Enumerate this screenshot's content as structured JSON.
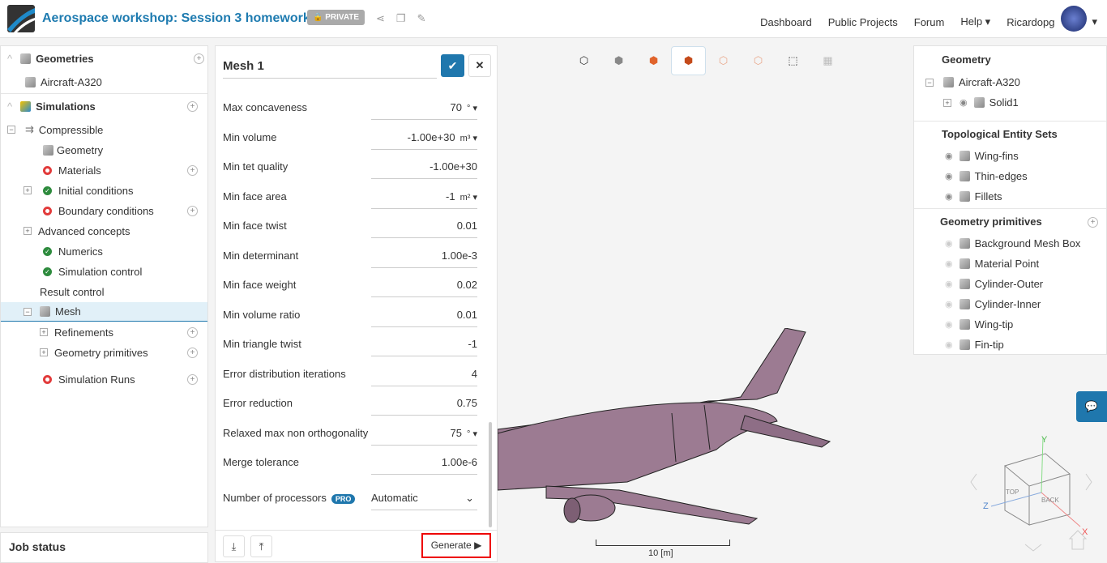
{
  "header": {
    "title": "Aerospace workshop: Session 3 homework",
    "privacy": "PRIVATE",
    "nav": [
      "Dashboard",
      "Public Projects",
      "Forum",
      "Help",
      "Ricardopg"
    ]
  },
  "tree": {
    "geometries": "Geometries",
    "geometry_item": "Aircraft-A320",
    "simulations": "Simulations",
    "items": [
      {
        "label": "Compressible",
        "status": "none"
      },
      {
        "label": "Geometry",
        "status": "ok"
      },
      {
        "label": "Materials",
        "status": "error"
      },
      {
        "label": "Initial conditions",
        "status": "ok"
      },
      {
        "label": "Boundary conditions",
        "status": "error"
      },
      {
        "label": "Advanced concepts",
        "status": "none"
      },
      {
        "label": "Numerics",
        "status": "ok"
      },
      {
        "label": "Simulation control",
        "status": "ok"
      },
      {
        "label": "Result control",
        "status": "none"
      },
      {
        "label": "Mesh",
        "status": "selected"
      },
      {
        "label": "Refinements",
        "status": "none"
      },
      {
        "label": "Geometry primitives",
        "status": "none"
      },
      {
        "label": "Simulation Runs",
        "status": "error"
      }
    ]
  },
  "job_status": "Job status",
  "mesh_panel": {
    "name": "Mesh 1",
    "generate": "Generate",
    "properties": [
      {
        "label": "Max concaveness",
        "value": "70",
        "unit": "°"
      },
      {
        "label": "Min volume",
        "value": "-1.00e+30",
        "unit": "m³"
      },
      {
        "label": "Min tet quality",
        "value": "-1.00e+30",
        "unit": ""
      },
      {
        "label": "Min face area",
        "value": "-1",
        "unit": "m²"
      },
      {
        "label": "Min face twist",
        "value": "0.01",
        "unit": ""
      },
      {
        "label": "Min determinant",
        "value": "1.00e-3",
        "unit": ""
      },
      {
        "label": "Min face weight",
        "value": "0.02",
        "unit": ""
      },
      {
        "label": "Min volume ratio",
        "value": "0.01",
        "unit": ""
      },
      {
        "label": "Min triangle twist",
        "value": "-1",
        "unit": ""
      },
      {
        "label": "Error distribution iterations",
        "value": "4",
        "unit": ""
      },
      {
        "label": "Error reduction",
        "value": "0.75",
        "unit": ""
      },
      {
        "label": "Relaxed max non orthogonality",
        "value": "75",
        "unit": "°"
      },
      {
        "label": "Merge tolerance",
        "value": "1.00e-6",
        "unit": ""
      }
    ],
    "processors_label": "Number of processors",
    "pro_badge": "PRO",
    "processors_value": "Automatic"
  },
  "right_panel": {
    "geometry": "Geometry",
    "geometry_item": "Aircraft-A320",
    "solid": "Solid1",
    "topo_title": "Topological Entity Sets",
    "topo": [
      "Wing-fins",
      "Thin-edges",
      "Fillets"
    ],
    "prim_title": "Geometry primitives",
    "prims": [
      "Background Mesh Box",
      "Material Point",
      "Cylinder-Outer",
      "Cylinder-Inner",
      "Wing-tip",
      "Fin-tip"
    ]
  },
  "viewport": {
    "scale": "10 [m]",
    "cube": {
      "top": "TOP",
      "back": "BACK",
      "x": "X",
      "y": "Y",
      "z": "Z"
    }
  },
  "colors": {
    "brand": "#1f77ad",
    "ok": "#2e8b3e",
    "error": "#e23b3b",
    "aircraft": "#9c7b92"
  }
}
